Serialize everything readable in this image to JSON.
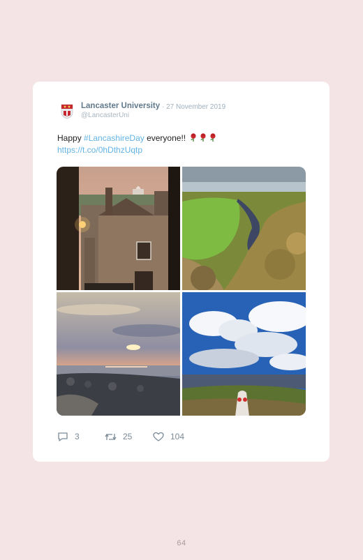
{
  "tweet": {
    "author_name": "Lancaster University",
    "date": "· 27 November 2019",
    "handle": "@LancasterUni",
    "text_prefix": "Happy ",
    "hashtag": "#LancashireDay",
    "text_suffix": " everyone!! ",
    "link": "https://t.co/0hDthzUqtp",
    "emoji_icons": [
      "rose-icon",
      "rose-icon",
      "rose-icon"
    ],
    "photos": [
      {
        "name": "photo-lancaster-street",
        "icon": "street-scene"
      },
      {
        "name": "photo-river-valley",
        "icon": "river-landscape"
      },
      {
        "name": "photo-sunset-coast",
        "icon": "sunset-seascape"
      },
      {
        "name": "photo-trig-point",
        "icon": "clouds-moorland"
      }
    ],
    "replies": "3",
    "retweets": "25",
    "likes": "104"
  },
  "page_number": "64",
  "colors": {
    "background": "#f5e4e5",
    "card": "#ffffff",
    "link": "#63b3e3",
    "name": "#61798b",
    "muted": "#9fb0bd"
  }
}
